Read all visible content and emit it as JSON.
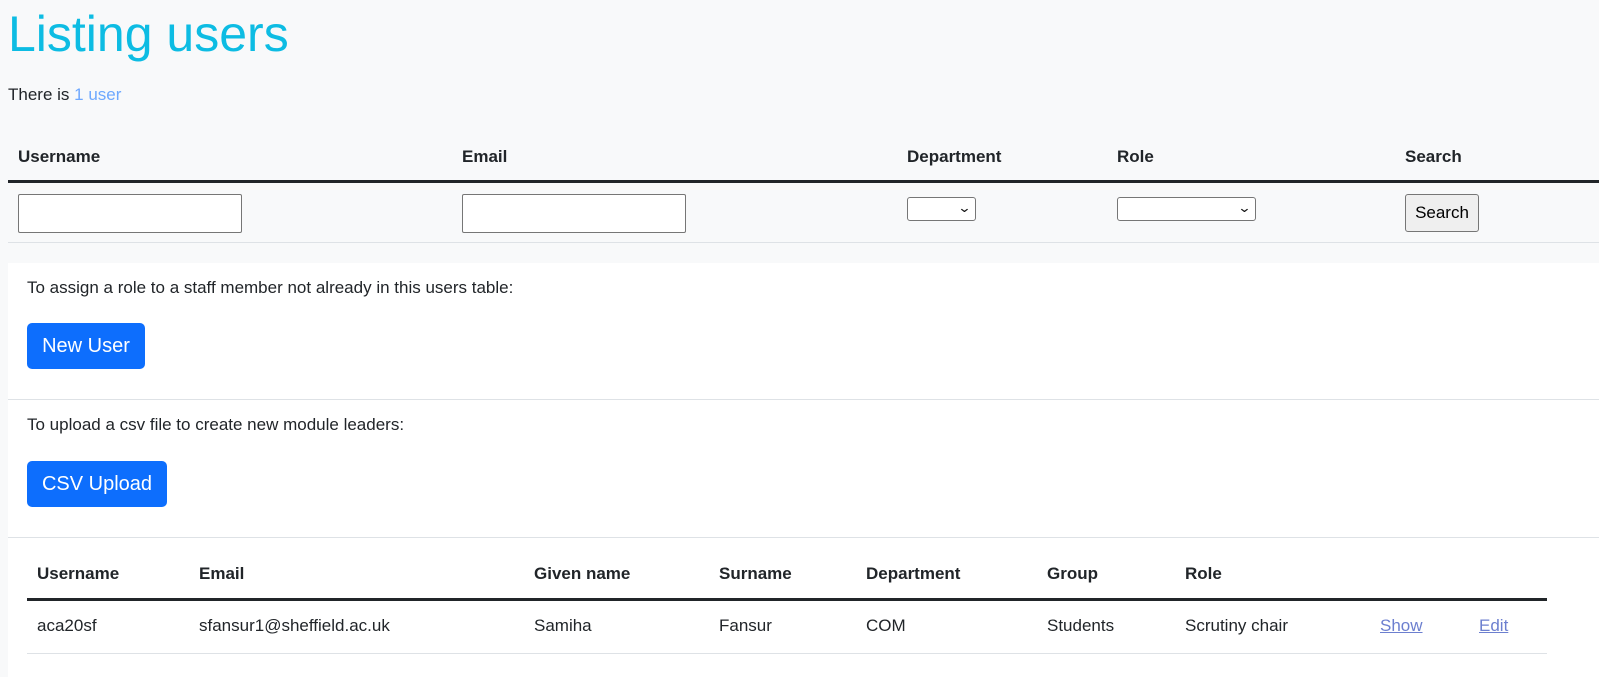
{
  "page": {
    "title": "Listing users",
    "count_prefix": "There is",
    "count_link": "1 user"
  },
  "filters": {
    "headers": {
      "username": "Username",
      "email": "Email",
      "department": "Department",
      "role": "Role",
      "search": "Search"
    },
    "username_value": "",
    "email_value": "",
    "department_selected": "",
    "role_selected": "",
    "search_button": "Search"
  },
  "new_user_section": {
    "text": "To assign a role to a staff member not already in this users table:",
    "button": "New User"
  },
  "csv_section": {
    "text": "To upload a csv file to create new module leaders:",
    "button": "CSV Upload"
  },
  "users_table": {
    "headers": {
      "username": "Username",
      "email": "Email",
      "given_name": "Given name",
      "surname": "Surname",
      "department": "Department",
      "group": "Group",
      "role": "Role"
    },
    "rows": [
      {
        "username": "aca20sf",
        "email": "sfansur1@sheffield.ac.uk",
        "given_name": "Samiha",
        "surname": "Fansur",
        "department": "COM",
        "group": "Students",
        "role": "Scrutiny chair",
        "show": "Show",
        "edit": "Edit"
      }
    ]
  },
  "colors": {
    "title": "#0dbce3",
    "link": "#6ea8fe",
    "primary_button": "#0d6efd",
    "row_link": "#6c7fcf"
  },
  "icons": {
    "select_arrow": "chevron-down-icon"
  }
}
